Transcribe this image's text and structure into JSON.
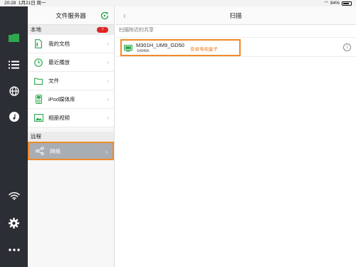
{
  "status_bar": {
    "time": "20:28",
    "date": "1月21日 周一",
    "battery": "84%",
    "battery_level": 0.84
  },
  "sidebar": {
    "title": "文件服务器",
    "local_label": "本地",
    "local_badge": "?",
    "local_items": [
      {
        "label": "我的文档",
        "icon": "document-icon"
      },
      {
        "label": "最近播放",
        "icon": "clock-icon"
      },
      {
        "label": "文件",
        "icon": "folder-icon"
      },
      {
        "label": "iPod媒体库",
        "icon": "ipod-icon"
      },
      {
        "label": "相册视频",
        "icon": "photo-video-icon"
      }
    ],
    "remote_label": "远程",
    "remote_items": [
      {
        "label": "网络",
        "icon": "share-network-icon",
        "selected": true
      }
    ]
  },
  "main": {
    "title": "扫描",
    "section_label": "扫描附近的共享",
    "shares": [
      {
        "name": "M301H_UM9_GD50",
        "type": "SAMBA",
        "note": "安卓电视盒子"
      }
    ]
  },
  "colors": {
    "rail": "#2b2e34",
    "accent_green": "#2fa84f",
    "highlight": "#f08a2a",
    "badge": "#e02424"
  }
}
